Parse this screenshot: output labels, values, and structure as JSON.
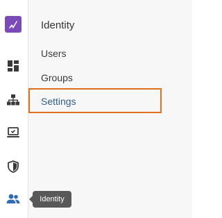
{
  "brand": {
    "logo_icon": "brand-logo-icon",
    "accent": "#7b4ab8"
  },
  "rail": {
    "icons": [
      {
        "name": "dashboard-icon",
        "color": "#3a3a3a"
      },
      {
        "name": "hierarchy-icon",
        "color": "#3a3a3a"
      },
      {
        "name": "device-icon",
        "color": "#3a3a3a"
      },
      {
        "name": "shield-icon",
        "color": "#3a3a3a"
      },
      {
        "name": "identity-icon",
        "color": "#2f6cb3",
        "active": true
      }
    ]
  },
  "panel": {
    "title": "Identity",
    "items": [
      {
        "label": "Users"
      },
      {
        "label": "Groups"
      },
      {
        "label": "Settings",
        "active": true
      }
    ]
  },
  "tooltip": {
    "text": "Identity"
  },
  "colors": {
    "focus_outline": "#e0701f",
    "active_link": "#2f5e86"
  }
}
